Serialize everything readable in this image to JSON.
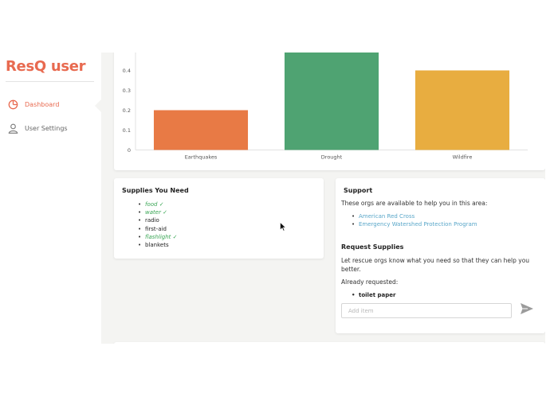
{
  "app": {
    "brand": "ResQ user",
    "colors": {
      "brand": "#e86a50",
      "link": "#5aa7c9",
      "checked": "#3aa655"
    }
  },
  "sidebar": {
    "items": [
      {
        "label": "Dashboard",
        "icon": "pie-chart-icon",
        "active": true
      },
      {
        "label": "User Settings",
        "icon": "user-icon",
        "active": false
      }
    ]
  },
  "chart_data": {
    "type": "bar",
    "categories": [
      "Earthquakes",
      "Drought",
      "Wildfire"
    ],
    "values": [
      0.2,
      0.5,
      0.4
    ],
    "colors": [
      "#e87a45",
      "#4fa372",
      "#e8ad40"
    ],
    "ylim": [
      0,
      0.5
    ],
    "yticks": [
      "0",
      "0.1",
      "0.2",
      "0.3",
      "0.4"
    ],
    "title": "",
    "xlabel": "",
    "ylabel": ""
  },
  "supplies": {
    "title": "Supplies You Need",
    "items": [
      {
        "label": "food ✓",
        "have": true
      },
      {
        "label": "water ✓",
        "have": true
      },
      {
        "label": "radio",
        "have": false
      },
      {
        "label": "first-aid",
        "have": false
      },
      {
        "label": "flashlight ✓",
        "have": true
      },
      {
        "label": "blankets",
        "have": false
      }
    ]
  },
  "support": {
    "title": "Support",
    "intro": "These orgs are available to help you in this area:",
    "orgs": [
      "American Red Cross",
      "Emergency Watershed Protection Program"
    ],
    "request_title": "Request Supplies",
    "request_text": "Let rescue orgs know what you need so that they can help you better.",
    "already_label": "Already requested:",
    "requested": [
      "toilet paper"
    ],
    "input_placeholder": "Add item",
    "send_icon": "send-icon"
  }
}
